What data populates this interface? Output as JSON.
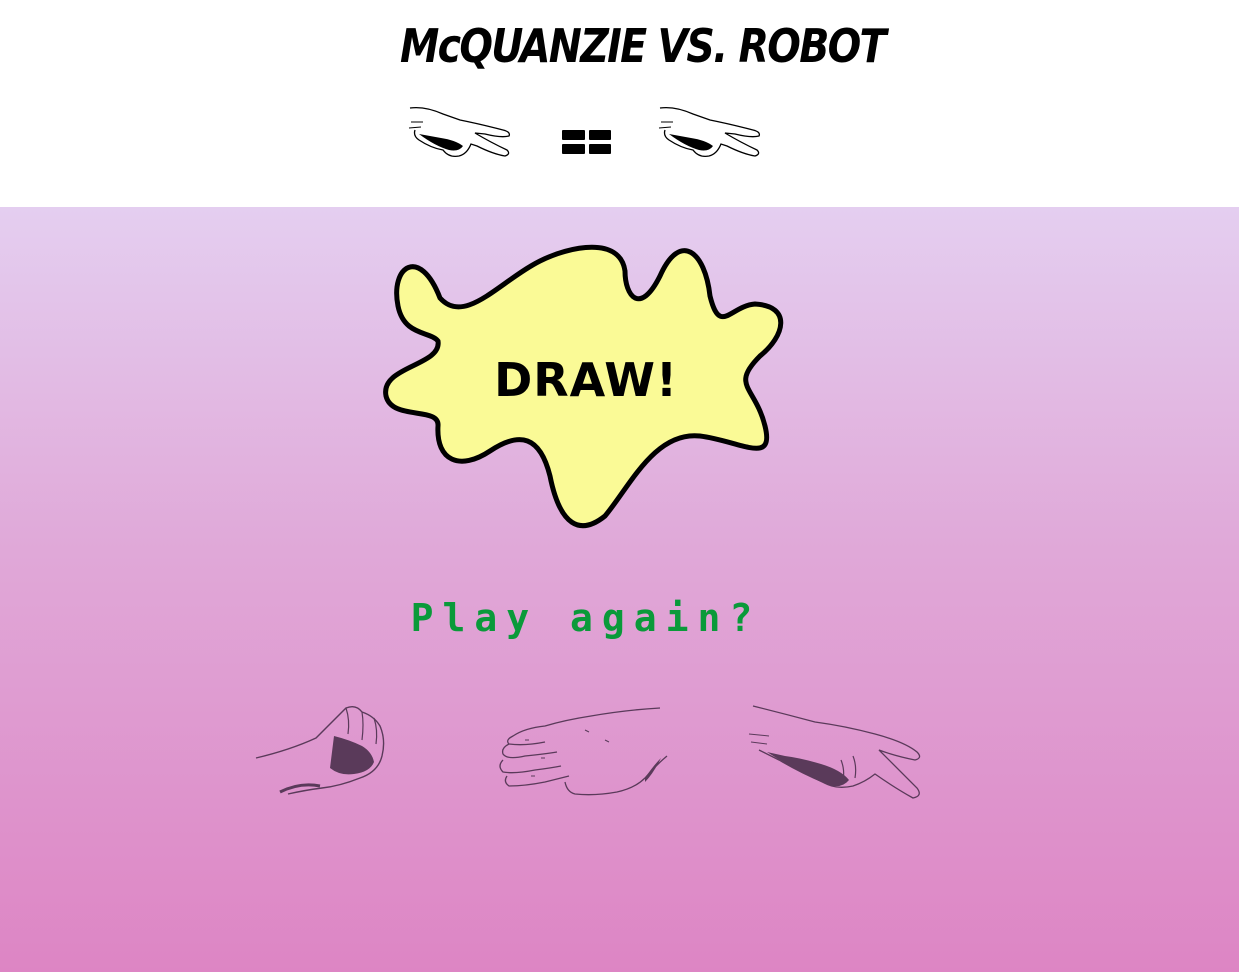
{
  "header": {
    "title": "McQUANZIE VS. ROBOT",
    "player_hand_icon": "scissors-hand-icon",
    "robot_hand_icon": "scissors-hand-icon",
    "versus_icon": "equals-icon"
  },
  "result": {
    "text": "DRAW!",
    "splat_color": "#fafa96"
  },
  "actions": {
    "play_again": "Play again?",
    "play_again_color": "#0a9a3a"
  },
  "choices": [
    {
      "name": "rock",
      "icon": "rock-hand-icon"
    },
    {
      "name": "paper",
      "icon": "paper-hand-icon"
    },
    {
      "name": "scissors",
      "icon": "scissors-hand-icon"
    }
  ],
  "colors": {
    "arena_top": "#e4cef0",
    "arena_bottom": "#dd85c4",
    "choice_line": "#5a3a5a"
  }
}
